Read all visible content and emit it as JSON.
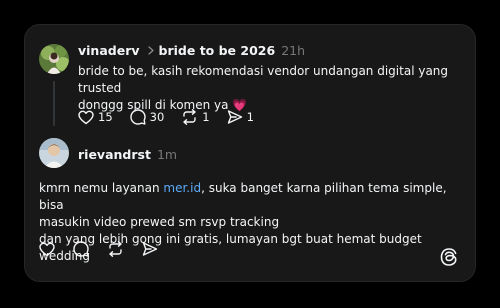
{
  "post1": {
    "username": "vinaderv",
    "community": "bride to be 2026",
    "time": "21h",
    "text_line1": "bride to be, kasih rekomendasi vendor undangan digital yang trusted",
    "text_line2": "donggg spill di komen ya",
    "emoji": "💗",
    "likes": "15",
    "replies": "30",
    "reposts": "1",
    "shares": "1",
    "avatar_icon": "avatar-photo-icon"
  },
  "post2": {
    "username": "rievandrst",
    "time": "1m",
    "text_prefix": "kmrn nemu layanan ",
    "link": "mer.id",
    "text_suffix": ", suka banget karna pilihan tema simple, bisa",
    "text_line2": "masukin video prewed sm rsvp tracking",
    "text_line3": "dan yang lebih gong ini gratis, lumayan bgt buat hemat budget wedding",
    "avatar_icon": "avatar-photo-icon"
  },
  "colors": {
    "background": "#000000",
    "card": "#181818",
    "text": "#f3f5f7",
    "muted": "#777777",
    "link": "#5cabf6"
  }
}
